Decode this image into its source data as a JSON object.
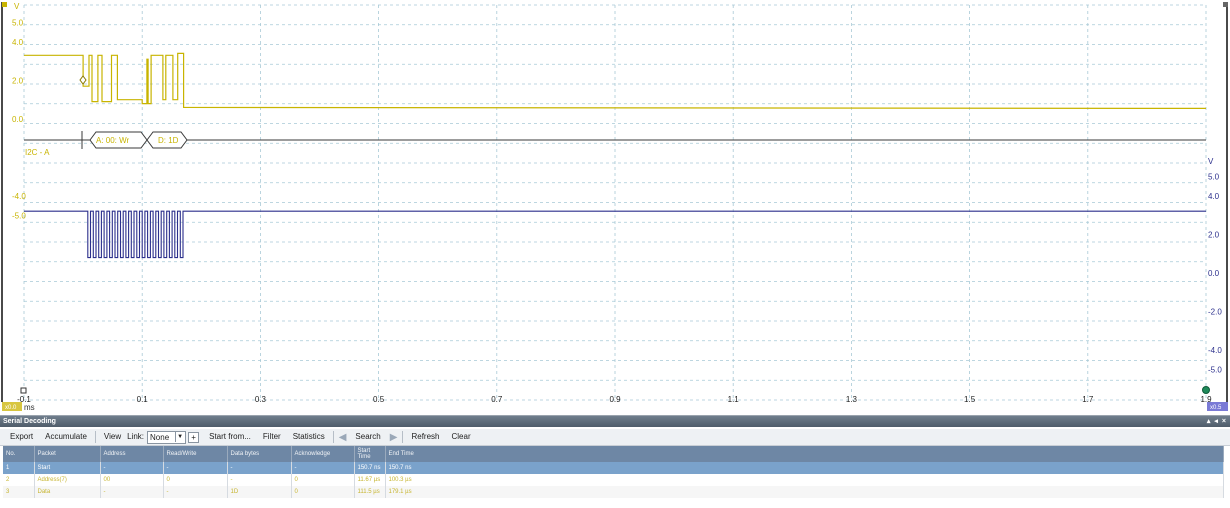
{
  "scope": {
    "left_axis": {
      "unit": "V",
      "ticks": [
        "5.0",
        "4.0",
        "2.0",
        "0.0",
        "-4.0",
        "-5.0"
      ],
      "color": "#c8b400"
    },
    "right_axis": {
      "unit": "V",
      "ticks": [
        "5.0",
        "4.0",
        "2.0",
        "0.0",
        "-2.0",
        "-4.0",
        "-5.0"
      ],
      "color": "#2b2f8c"
    },
    "time_axis": {
      "unit": "ms",
      "ticks": [
        "-0.1",
        "0.1",
        "0.3",
        "0.5",
        "0.7",
        "0.9",
        "1.1",
        "1.3",
        "1.5",
        "1.7",
        "1.9"
      ],
      "left_badge": "x0.0",
      "right_badge": "x0.5"
    },
    "decode_label": "I2C - A",
    "packets": [
      {
        "label": "A: 00: Wr"
      },
      {
        "label": "D: 1D"
      }
    ],
    "channel_a_color": "#c8b400",
    "channel_b_color": "#2b2f8c",
    "grid_color": "#a8c9d6"
  },
  "panel": {
    "title": "Serial Decoding",
    "window_buttons": [
      "▴",
      "◂",
      "×"
    ],
    "toolbar": {
      "export": "Export",
      "accumulate": "Accumulate",
      "view": "View",
      "link_label": "Link:",
      "link_value": "None",
      "add": "+",
      "start_from": "Start from...",
      "filter": "Filter",
      "statistics": "Statistics",
      "search": "Search",
      "refresh": "Refresh",
      "clear": "Clear"
    },
    "table": {
      "columns": [
        "No.",
        "Packet",
        "Address",
        "Read/Write",
        "Data bytes",
        "Acknowledge",
        "Start Time",
        "End Time"
      ],
      "rows": [
        [
          "1",
          "Start",
          "-",
          "-",
          "-",
          "-",
          "150.7 ns",
          "150.7 ns"
        ],
        [
          "2",
          "Address(7)",
          "00",
          "0",
          "-",
          "0",
          "11.67 µs",
          "100.3 µs"
        ],
        [
          "3",
          "Data",
          "-",
          "-",
          "1D",
          "0",
          "111.5 µs",
          "179.1 µs"
        ]
      ]
    }
  }
}
